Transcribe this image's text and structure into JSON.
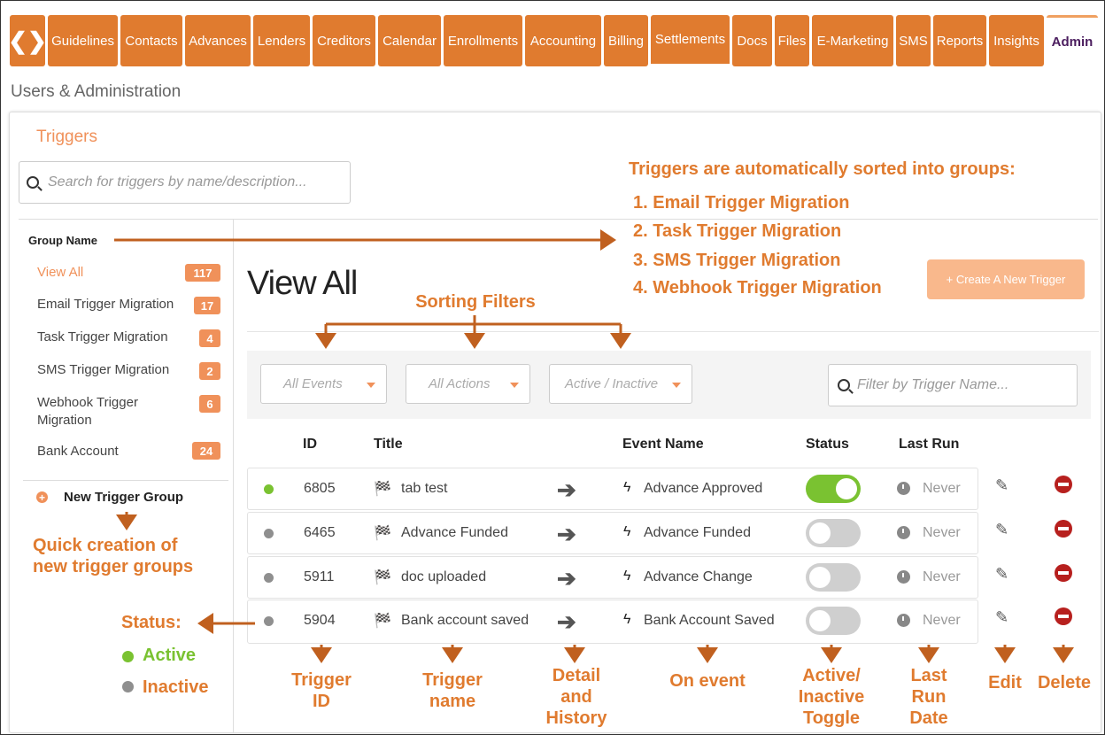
{
  "nav": {
    "tabs": [
      "Guidelines",
      "Contacts",
      "Advances",
      "Lenders",
      "Creditors",
      "Calendar",
      "Enrollments",
      "Accounting",
      "Billing",
      "Settlements",
      "Docs",
      "Files",
      "E-Marketing",
      "SMS",
      "Reports",
      "Insights",
      "Admin"
    ]
  },
  "page": {
    "section_title": "Users & Administration",
    "heading": "Triggers"
  },
  "search": {
    "placeholder": "Search for triggers by name/description..."
  },
  "groups": {
    "header": "Group Name",
    "items": [
      {
        "label": "View All",
        "count": "117"
      },
      {
        "label": "Email Trigger Migration",
        "count": "17"
      },
      {
        "label": "Task Trigger Migration",
        "count": "4"
      },
      {
        "label": "SMS Trigger Migration",
        "count": "2"
      },
      {
        "label": "Webhook Trigger",
        "label2": "Migration",
        "count": "6"
      },
      {
        "label": "Bank Account",
        "count": "24"
      }
    ],
    "new_group": "New Trigger Group"
  },
  "main": {
    "title": "View All",
    "create_button": "+ Create A New Trigger",
    "filters": {
      "events": "All Events",
      "actions": "All Actions",
      "status": "Active / Inactive",
      "name_placeholder": "Filter by Trigger Name..."
    },
    "columns": {
      "id": "ID",
      "title": "Title",
      "event": "Event Name",
      "status": "Status",
      "last_run": "Last Run"
    },
    "rows": [
      {
        "id": "6805",
        "title": "tab test",
        "event": "Advance Approved",
        "active": true,
        "last_run": "Never"
      },
      {
        "id": "6465",
        "title": "Advance Funded",
        "event": "Advance Funded",
        "active": false,
        "last_run": "Never"
      },
      {
        "id": "5911",
        "title": "doc uploaded",
        "event": "Advance  Change",
        "active": false,
        "last_run": "Never"
      },
      {
        "id": "5904",
        "title": "Bank account saved",
        "event": "Bank Account Saved",
        "active": false,
        "last_run": "Never"
      }
    ]
  },
  "annotations": {
    "groups_heading": "Triggers are automatically sorted into groups:",
    "groups_list": [
      "1.  Email Trigger Migration",
      "2.  Task Trigger Migration",
      "3.  SMS Trigger Migration",
      "4.  Webhook Trigger Migration"
    ],
    "sorting_filters": "Sorting Filters",
    "quick_creation": [
      "Quick creation of",
      "new trigger groups"
    ],
    "status_title": "Status:",
    "status_active": "Active",
    "status_inactive": "Inactive",
    "trigger_id": [
      "Trigger",
      "ID"
    ],
    "trigger_name": [
      "Trigger",
      "name"
    ],
    "detail_history": [
      "Detail",
      "and",
      "History"
    ],
    "on_event": "On event",
    "toggle": [
      "Active/",
      "Inactive",
      "Toggle"
    ],
    "last_run_date": [
      "Last",
      "Run",
      "Date"
    ],
    "edit": "Edit",
    "delete": "Delete"
  },
  "colors": {
    "brand_orange": "#e07b2f",
    "accent_orange": "#f0915a",
    "active_green": "#7ac231",
    "inactive_gray": "#8f8f8f",
    "delete_red": "#b7201e",
    "admin_purple": "#4b1d5e"
  }
}
